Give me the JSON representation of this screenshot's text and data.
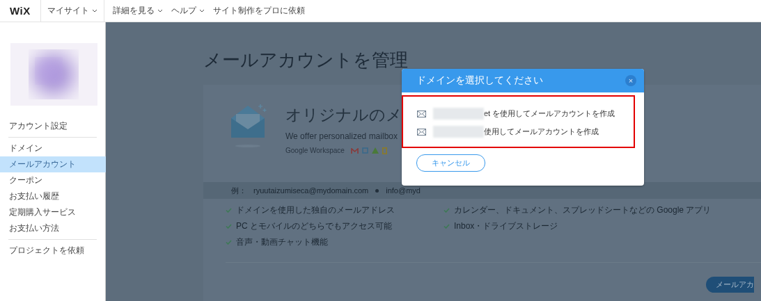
{
  "topbar": {
    "logo": "WiX",
    "nav": [
      {
        "label": "マイサイト",
        "has_menu": true
      },
      {
        "label": "詳細を見る",
        "has_menu": true
      },
      {
        "label": "ヘルプ",
        "has_menu": true
      },
      {
        "label": "サイト制作をプロに依頼",
        "has_menu": false
      }
    ]
  },
  "sidebar": {
    "avatar": {
      "kind": "picture"
    },
    "groups": [
      [
        {
          "label": "アカウント設定",
          "selected": false
        }
      ],
      [
        {
          "label": "ドメイン",
          "selected": false
        },
        {
          "label": "メールアカウント",
          "selected": true
        },
        {
          "label": "クーポン",
          "selected": false
        },
        {
          "label": "お支払い履歴",
          "selected": false
        },
        {
          "label": "定期購入サービス",
          "selected": false
        },
        {
          "label": "お支払い方法",
          "selected": false
        }
      ],
      [
        {
          "label": "プロジェクトを依頼",
          "selected": false
        }
      ]
    ]
  },
  "main": {
    "title": "メールアカウントを管理",
    "card": {
      "headline": "オリジナルのメ",
      "subtitle": "We offer personalized mailbox",
      "workspace_label": "Google Workspace",
      "example_label": "例：",
      "examples": [
        "ryuutaizumiseca@mydomain.com",
        "info@myd"
      ],
      "features": [
        [
          "ドメインを使用した独自のメールアドレス",
          "PC とモバイルのどちらでもアクセス可能",
          "音声・動画チャット機能"
        ],
        [
          "カレンダー、ドキュメント、スプレッドシートなどの Google アプリ",
          "Inbox・ドライブストレージ"
        ]
      ],
      "button": "メールアカ"
    }
  },
  "dialog": {
    "title": "ドメインを選択してください",
    "close": "×",
    "options": [
      {
        "text": "et を使用してメールアカウントを作成"
      },
      {
        "text": "使用してメールアカウントを作成"
      }
    ],
    "cancel": "キャンセル"
  }
}
